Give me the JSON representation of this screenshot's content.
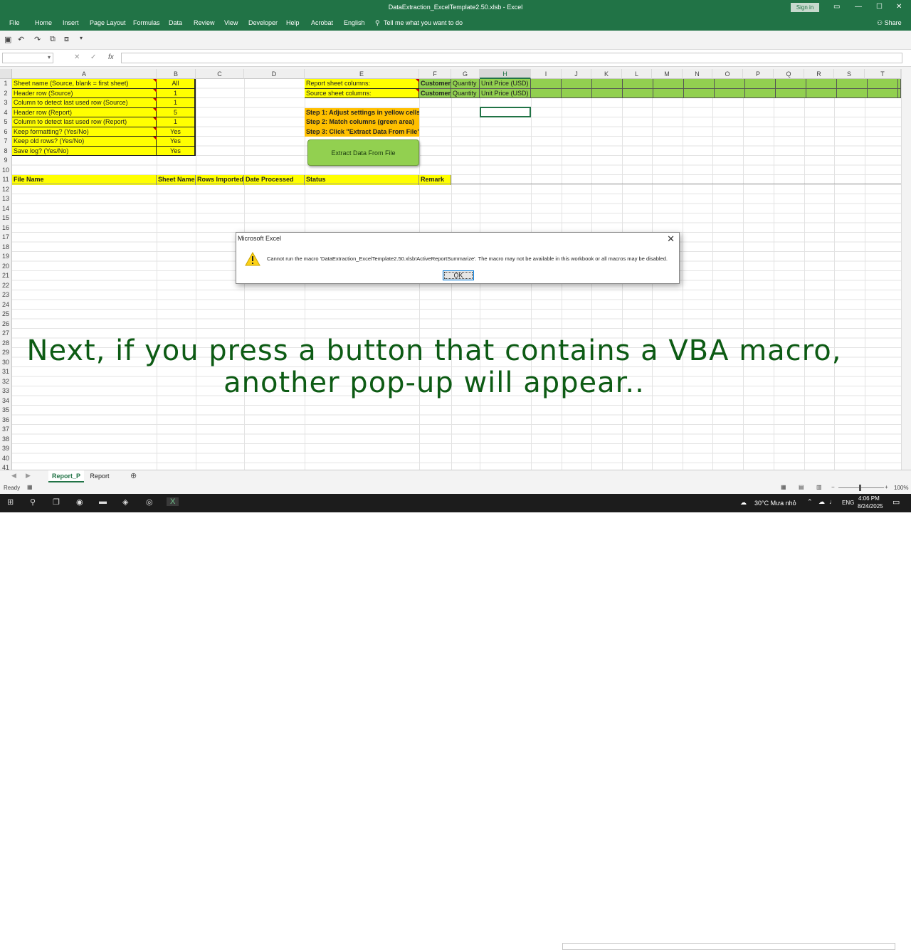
{
  "window": {
    "title": "DataExtraction_ExcelTemplate2.50.xlsb  -  Excel",
    "sign_in": "Sign in",
    "share": "Share"
  },
  "ribbon_tabs": [
    "File",
    "Home",
    "Insert",
    "Page Layout",
    "Formulas",
    "Data",
    "Review",
    "View",
    "Developer",
    "Help",
    "Acrobat",
    "English"
  ],
  "tell_me": "Tell me what you want to do",
  "formula_bar": {
    "fx": "fx",
    "name_box": "",
    "value": ""
  },
  "columns": [
    "A",
    "B",
    "C",
    "D",
    "E",
    "F",
    "G",
    "H",
    "I",
    "J",
    "K",
    "L",
    "M",
    "N",
    "O",
    "P",
    "Q",
    "R",
    "S",
    "T"
  ],
  "rows": [
    "1",
    "2",
    "3",
    "4",
    "5",
    "6",
    "7",
    "8",
    "9",
    "10",
    "11",
    "12",
    "13",
    "14",
    "15",
    "16",
    "17",
    "18",
    "19",
    "20",
    "21",
    "22",
    "23",
    "24",
    "25",
    "26",
    "27",
    "28",
    "29",
    "30",
    "31",
    "32",
    "33",
    "34",
    "35",
    "36",
    "37",
    "38",
    "39",
    "40",
    "41"
  ],
  "settings": [
    {
      "label": "Sheet name (Source, blank = first sheet)",
      "value": "All"
    },
    {
      "label": "Header row (Source)",
      "value": "1"
    },
    {
      "label": "Column to detect last used row (Source)",
      "value": "1"
    },
    {
      "label": "Header row (Report)",
      "value": "5"
    },
    {
      "label": "Column to detect last used row (Report)",
      "value": "1"
    },
    {
      "label": "Keep formatting? (Yes/No)",
      "value": "Yes"
    },
    {
      "label": "Keep old rows? (Yes/No)",
      "value": "Yes"
    },
    {
      "label": "Save log? (Yes/No)",
      "value": "Yes"
    }
  ],
  "mapping": {
    "report_label": "Report sheet columns:",
    "source_label": "Source sheet columns:",
    "report_cols": [
      "Customer",
      "Quantity",
      "Unit Price (USD)"
    ],
    "source_cols": [
      "Customer",
      "Quantity",
      "Unit Price (USD)"
    ]
  },
  "steps": [
    "Step 1: Adjust settings in yellow cells",
    "Step 2: Match columns (green area)",
    "Step 3: Click \"Extract Data From File\""
  ],
  "extract_button": "Extract Data From File",
  "log_headers": [
    "File Name",
    "Sheet Name",
    "Rows Imported",
    "Date Processed",
    "Status",
    "Remark"
  ],
  "dialog": {
    "title": "Microsoft Excel",
    "message": "Cannot run the macro 'DataExtraction_ExcelTemplate2.50.xlsb!ActiveReportSummarize'. The macro may not be available in this workbook or all macros may be disabled.",
    "ok": "OK"
  },
  "caption": {
    "line1": "Next, if you press a button that contains a VBA macro,",
    "line2": "another pop-up will appear.."
  },
  "sheets": [
    "Report_P",
    "Report"
  ],
  "active_sheet": "Report_P",
  "status": {
    "ready": "Ready",
    "zoom": "100%"
  },
  "taskbar": {
    "weather": "30°C  Mưa nhỏ",
    "lang": "ENG",
    "time": "4:06 PM",
    "date": "8/24/2025"
  },
  "colors": {
    "excel_green": "#217346",
    "yellow": "#ffff00",
    "green_area": "#92d050",
    "orange": "#ffc000",
    "caption": "#0d5b14"
  }
}
